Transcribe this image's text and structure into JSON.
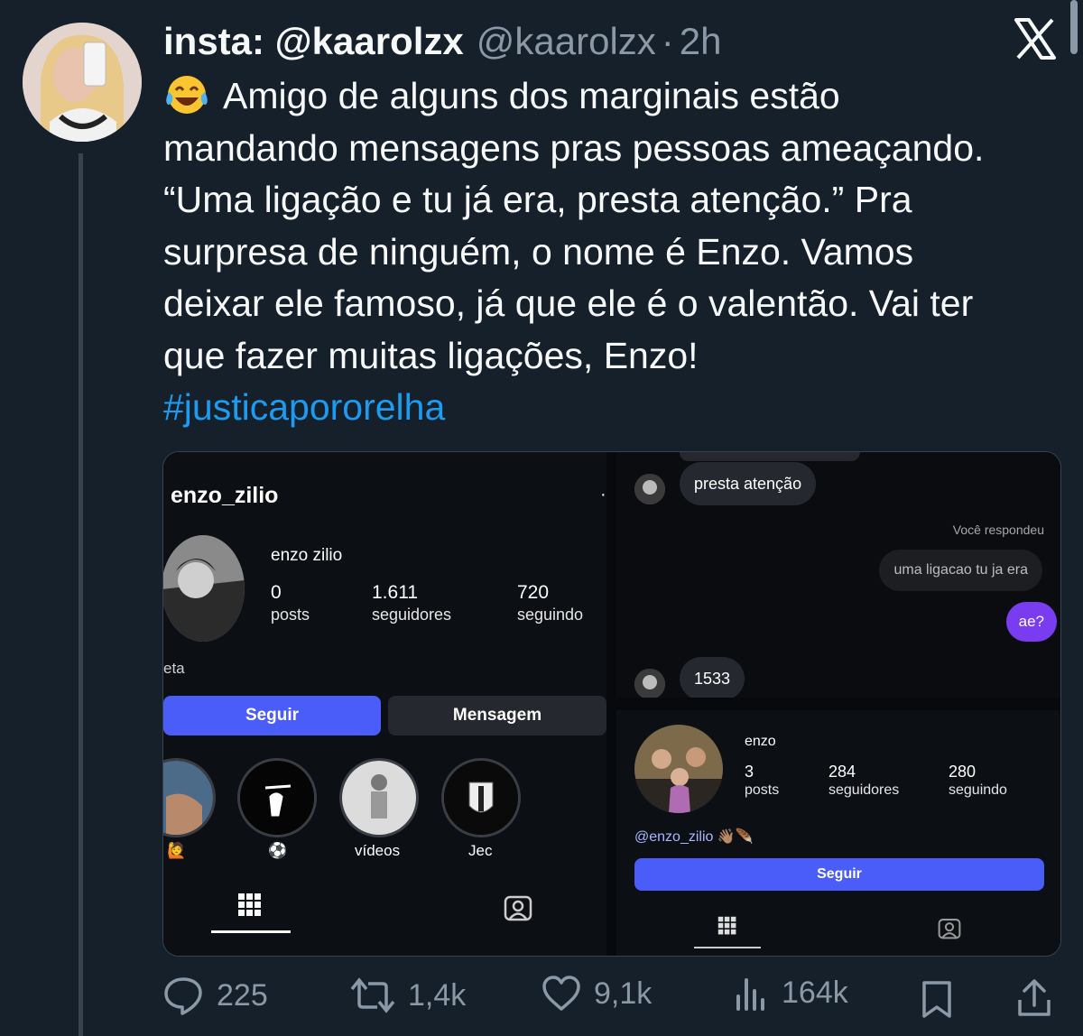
{
  "author": {
    "display_name": "insta: @kaarolzx",
    "handle": "@kaarolzx",
    "separator": "·",
    "time": "2h"
  },
  "tweet": {
    "lines": [
      "Amigo de alguns dos marginais estão",
      "mandando mensagens pras pessoas ameaçando.",
      "“Uma ligação e tu já era, presta atenção.” Pra",
      "surpresa de ninguém, o nome é Enzo. Vamos",
      "deixar ele famoso, já que ele é o valentão. Vai ter",
      "que fazer muitas ligações, Enzo!"
    ],
    "hashtag": "#justicapororelha"
  },
  "media": {
    "left_profile": {
      "username": "enzo_zilio",
      "name": "enzo zilio",
      "stats": [
        {
          "value": "0",
          "label": "posts"
        },
        {
          "value": "1.611",
          "label": "seguidores"
        },
        {
          "value": "720",
          "label": "seguindo"
        }
      ],
      "bio_fragment": "eta",
      "follow_button": "Seguir",
      "message_button": "Mensagem",
      "highlights": [
        "🙋",
        "⚽",
        "vídeos",
        "Jec"
      ]
    },
    "chat": {
      "messages": [
        {
          "from": "them",
          "text": "presta atenção"
        },
        {
          "from": "meta",
          "text": "Você respondeu"
        },
        {
          "from": "quoted",
          "text": "uma ligacao tu ja era"
        },
        {
          "from": "me",
          "text": "ae?"
        },
        {
          "from": "them",
          "text": "1533"
        }
      ]
    },
    "right_profile": {
      "name": "enzo",
      "stats": [
        {
          "value": "3",
          "label": "posts"
        },
        {
          "value": "284",
          "label": "seguidores"
        },
        {
          "value": "280",
          "label": "seguindo"
        }
      ],
      "bio_link": "@enzo_zilio",
      "bio_emoji": "👋🏽🪶",
      "follow_button": "Seguir"
    }
  },
  "actions": {
    "replies": "225",
    "reposts": "1,4k",
    "likes": "9,1k",
    "views": "164k"
  },
  "colors": {
    "background": "#15202b",
    "text": "#f7f9f9",
    "muted": "#8b98a5",
    "link": "#1d9bf0",
    "ig_blue": "#4a5df9",
    "dm_purple": "#7a3cf0"
  }
}
